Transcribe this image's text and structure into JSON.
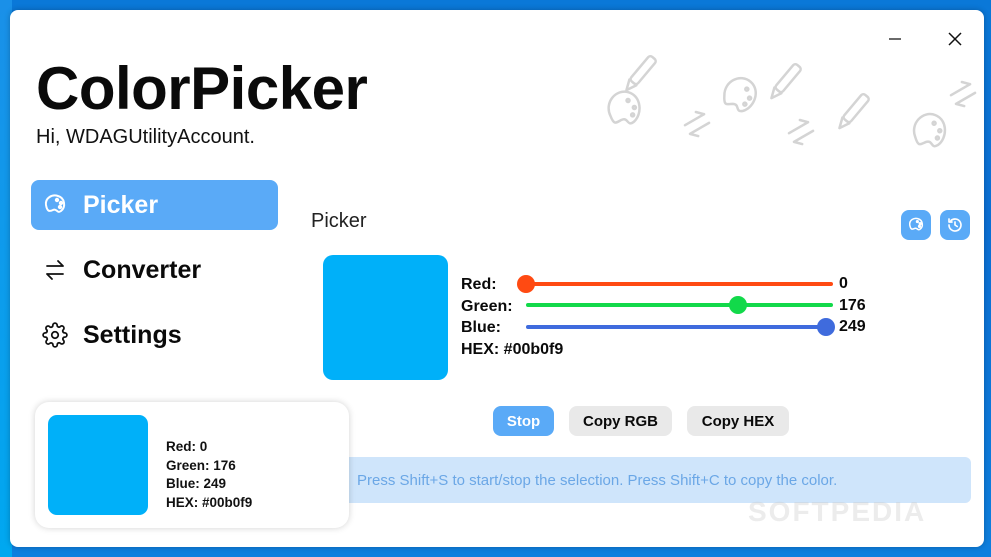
{
  "window": {
    "title": "ColorPicker",
    "greeting": "Hi, WDAGUtilityAccount.",
    "controls": {
      "minimize_icon": "minimize-icon",
      "close_icon": "close-icon"
    }
  },
  "sidebar": {
    "items": [
      {
        "label": "Picker",
        "icon": "palette-icon",
        "active": true
      },
      {
        "label": "Converter",
        "icon": "arrows-swap-icon",
        "active": false
      },
      {
        "label": "Settings",
        "icon": "gear-icon",
        "active": false
      }
    ]
  },
  "picker": {
    "section_title": "Picker",
    "toolbar": {
      "palette_button_icon": "palette-icon",
      "history_button_icon": "history-icon"
    },
    "color_hex": "#00b0f9",
    "labels": {
      "red": "Red:",
      "green": "Green:",
      "blue": "Blue:",
      "hex": "HEX: #00b0f9"
    },
    "sliders": {
      "red": {
        "value": 0,
        "display": "0",
        "max": 255,
        "color": "#ff4a12"
      },
      "green": {
        "value": 176,
        "display": "176",
        "max": 255,
        "color": "#12d94a"
      },
      "blue": {
        "value": 249,
        "display": "249",
        "max": 255,
        "color": "#3f6bdd"
      }
    },
    "buttons": {
      "stop": "Stop",
      "copy_rgb": "Copy RGB",
      "copy_hex": "Copy HEX"
    },
    "hint": "Press Shift+S to start/stop the selection. Press Shift+C to copy the color."
  },
  "preview_card": {
    "color_hex": "#00b0f9",
    "red": "Red: 0",
    "green": "Green: 176",
    "blue": "Blue: 249",
    "hex": "HEX: #00b0f9"
  },
  "colors": {
    "accent": "#5aaaf7",
    "button_neutral": "#e9e9e9",
    "hint_bg": "#cfe5fb",
    "hint_text": "#6ba7e6"
  },
  "watermark": "SOFTPEDIA"
}
